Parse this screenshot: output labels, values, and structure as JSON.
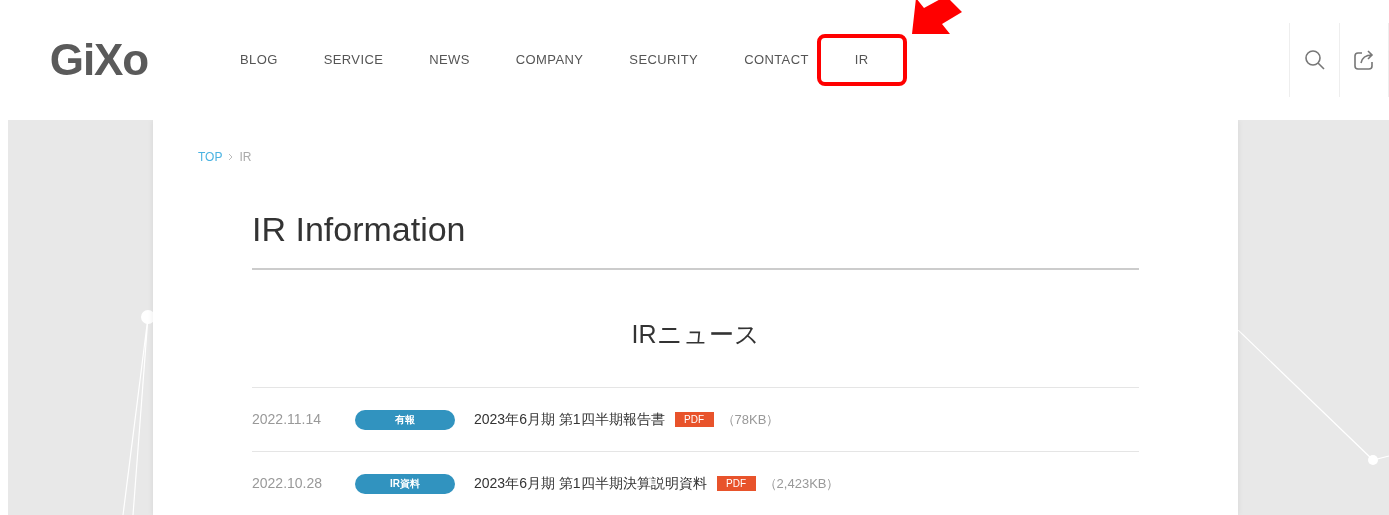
{
  "header": {
    "logo": "GiXo",
    "nav": [
      {
        "label": "BLOG",
        "highlighted": false
      },
      {
        "label": "SERVICE",
        "highlighted": false
      },
      {
        "label": "NEWS",
        "highlighted": false
      },
      {
        "label": "COMPANY",
        "highlighted": false
      },
      {
        "label": "SECURITY",
        "highlighted": false
      },
      {
        "label": "CONTACT",
        "highlighted": false
      },
      {
        "label": "IR",
        "highlighted": true
      }
    ]
  },
  "breadcrumb": [
    {
      "label": "TOP",
      "kind": "link"
    },
    {
      "label": "IR",
      "kind": "current"
    }
  ],
  "page_title": "IR Information",
  "section_title": "IRニュース",
  "news": [
    {
      "date": "2022.11.14",
      "tag": "有報",
      "title": "2023年6月期 第1四半期報告書",
      "file_type": "PDF",
      "size": "（78KB）"
    },
    {
      "date": "2022.10.28",
      "tag": "IR資料",
      "title": "2023年6月期 第1四半期決算説明資料",
      "file_type": "PDF",
      "size": "（2,423KB）"
    }
  ]
}
